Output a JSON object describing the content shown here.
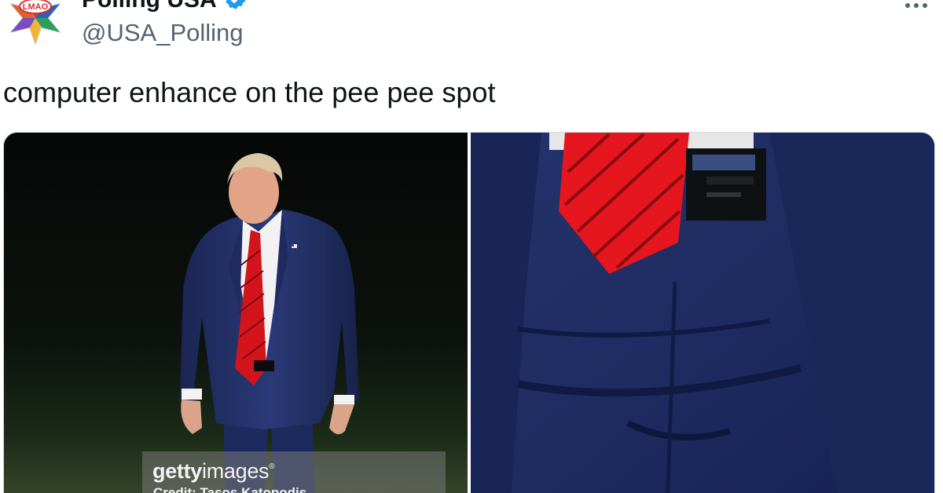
{
  "tweet": {
    "display_name": "Polling USA",
    "handle": "@USA_Polling",
    "text": "computer enhance on the pee pee spot",
    "avatar_icon": "lmao-star-logo",
    "verified_icon": "verified-badge-icon",
    "more_icon": "more-options-icon"
  },
  "media": {
    "watermark": {
      "brand_bold": "getty",
      "brand_light": "images",
      "credit": "Credit: Tasos Katopodis"
    }
  },
  "colors": {
    "accent_blue": "#1d9bf0",
    "handle_gray": "#536471",
    "suit_navy": "#1c2a57",
    "tie_red": "#e0121b"
  }
}
